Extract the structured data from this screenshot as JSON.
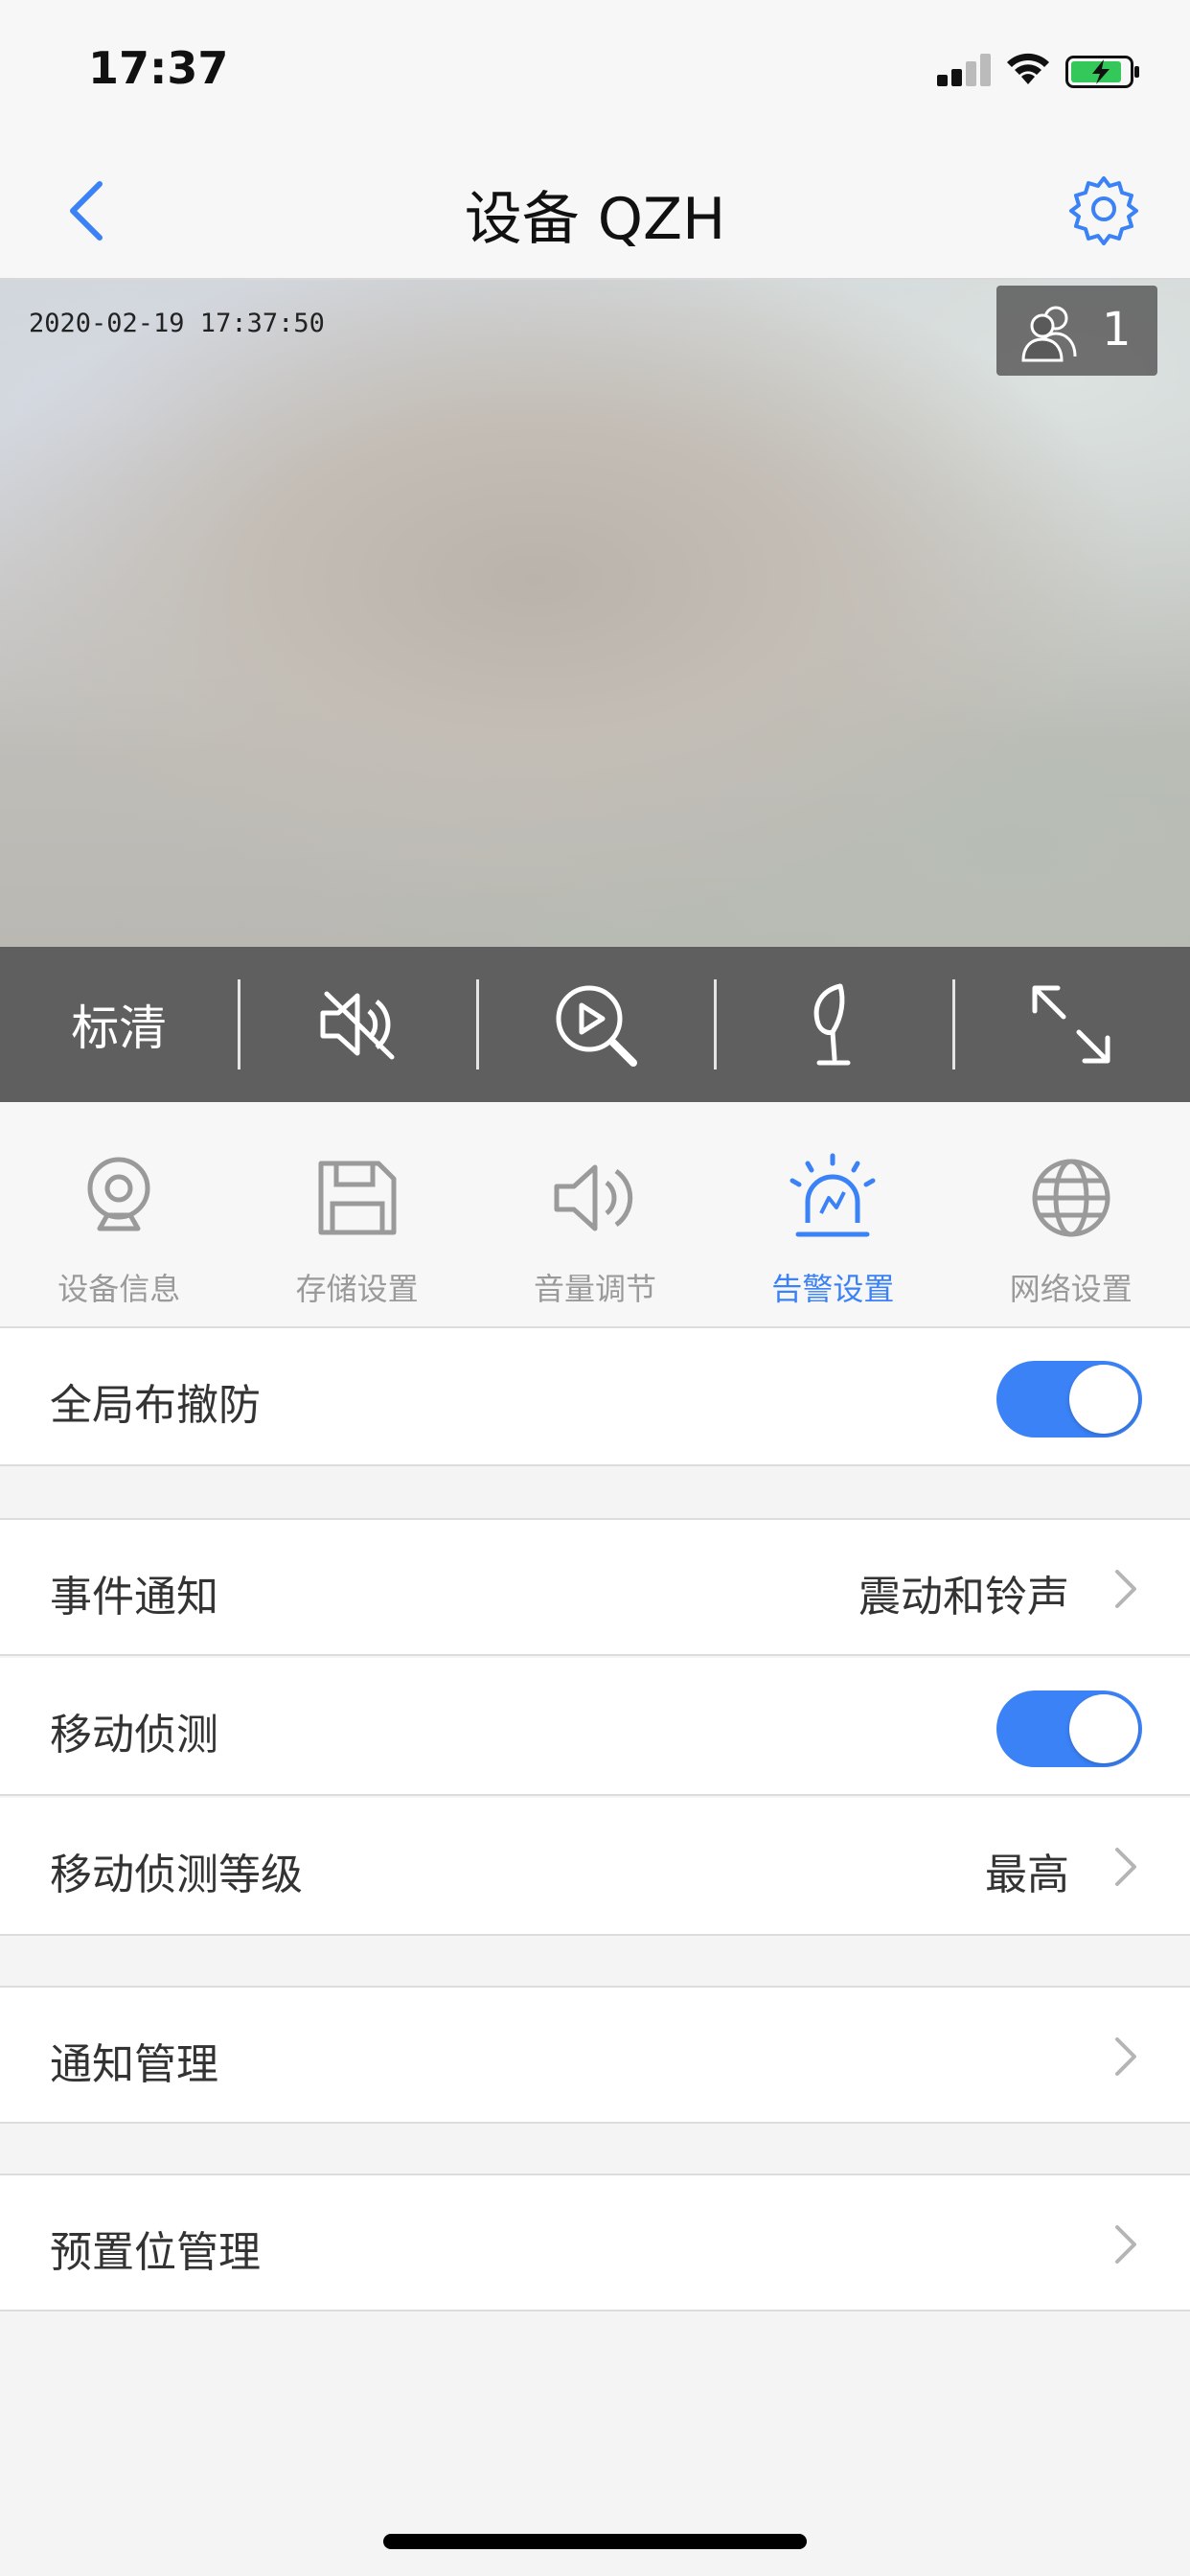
{
  "status_bar": {
    "time": "17:37",
    "icons": [
      "signal-icon",
      "wifi-icon",
      "battery-charging-icon"
    ]
  },
  "nav": {
    "title": "设备 QZH",
    "back_icon": "chevron-left-icon",
    "settings_icon": "gear-icon"
  },
  "video": {
    "timestamp": "2020-02-19 17:37:50",
    "viewer_count": "1",
    "viewer_icon": "users-icon"
  },
  "controls": {
    "quality_label": "标清",
    "items": [
      "quality",
      "mute-icon",
      "playback-search-icon",
      "intercom-icon",
      "fullscreen-icon"
    ]
  },
  "tabs": [
    {
      "label": "设备信息",
      "icon": "camera-icon",
      "active": false
    },
    {
      "label": "存储设置",
      "icon": "save-icon",
      "active": false
    },
    {
      "label": "音量调节",
      "icon": "speaker-icon",
      "active": false
    },
    {
      "label": "告警设置",
      "icon": "alarm-light-icon",
      "active": true
    },
    {
      "label": "网络设置",
      "icon": "globe-icon",
      "active": false
    }
  ],
  "settings": {
    "global_arm": {
      "label": "全局布撤防",
      "enabled": true
    },
    "event_notify": {
      "label": "事件通知",
      "value": "震动和铃声"
    },
    "motion_detect": {
      "label": "移动侦测",
      "enabled": true
    },
    "motion_level": {
      "label": "移动侦测等级",
      "value": "最高"
    },
    "notify_manage": {
      "label": "通知管理"
    },
    "preset_manage": {
      "label": "预置位管理"
    }
  },
  "colors": {
    "accent": "#3b82f6",
    "control_bar": "#5f5f5f",
    "tab_inactive": "#9a9a9a"
  }
}
